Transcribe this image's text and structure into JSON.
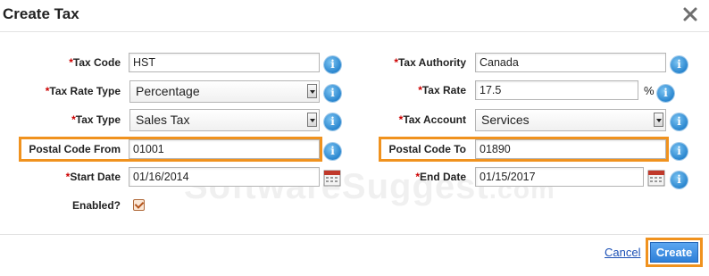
{
  "dialog": {
    "title": "Create Tax"
  },
  "form": {
    "required_mark": "*",
    "tax_code": {
      "label": "Tax Code",
      "value": "HST"
    },
    "tax_rate_type": {
      "label": "Tax Rate Type",
      "value": "Percentage"
    },
    "tax_type": {
      "label": "Tax Type",
      "value": "Sales Tax"
    },
    "postal_code_from": {
      "label": "Postal Code From",
      "value": "01001"
    },
    "start_date": {
      "label": "Start Date",
      "value": "01/16/2014"
    },
    "enabled": {
      "label": "Enabled?",
      "checked": true
    },
    "tax_authority": {
      "label": "Tax Authority",
      "value": "Canada"
    },
    "tax_rate": {
      "label": "Tax Rate",
      "value": "17.5",
      "unit": "%"
    },
    "tax_account": {
      "label": "Tax Account",
      "value": "Services"
    },
    "postal_code_to": {
      "label": "Postal Code To",
      "value": "01890"
    },
    "end_date": {
      "label": "End Date",
      "value": "01/15/2017"
    },
    "info_glyph": "i"
  },
  "footer": {
    "cancel_label": "Cancel",
    "create_label": "Create"
  },
  "watermark": {
    "text": "SoftwareSuggest",
    "suffix": ".com"
  },
  "colors": {
    "highlight": "#f0921e",
    "required": "#cc0000",
    "primary_button": "#2e7fd8",
    "info_icon": "#2a86cf"
  }
}
